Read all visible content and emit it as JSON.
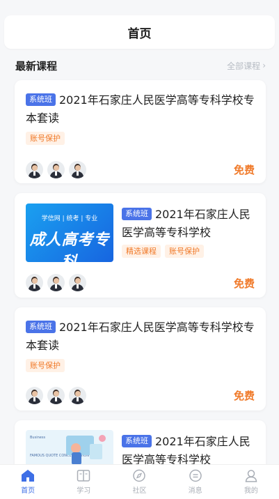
{
  "header": {
    "title": "首页"
  },
  "section": {
    "title": "最新课程",
    "more": "全部课程"
  },
  "cards": [
    {
      "badge": "系统班",
      "title": "2021年石家庄人民医学高等专科学校专本套读",
      "tags": [
        "账号保护"
      ],
      "price": "免费"
    },
    {
      "badge": "系统班",
      "title": "2021年石家庄人民医学高等专科学校",
      "tags": [
        "精选课程",
        "账号保护"
      ],
      "price": "免费",
      "thumb": {
        "small": "学信网 | 统考 | 专业",
        "big": "成人高考专科"
      }
    },
    {
      "badge": "系统班",
      "title": "2021年石家庄人民医学高等专科学校专本套读",
      "tags": [
        "账号保护"
      ],
      "price": "免费"
    },
    {
      "badge": "系统班",
      "title": "2021年石家庄人民医学高等专科学校",
      "thumb": {
        "mini": "Business",
        "mini2": "FAMOUS QUOTE CONCENTRATION"
      }
    }
  ],
  "tabbar": [
    {
      "label": "首页",
      "icon": "home-icon",
      "active": true
    },
    {
      "label": "学习",
      "icon": "book-icon",
      "active": false
    },
    {
      "label": "社区",
      "icon": "compass-icon",
      "active": false
    },
    {
      "label": "消息",
      "icon": "message-icon",
      "active": false
    },
    {
      "label": "我的",
      "icon": "user-icon",
      "active": false
    }
  ],
  "colors": {
    "accent": "#3e6fe6",
    "badge": "#4a73e8",
    "price": "#f07a2a",
    "tag_bg": "#fff1e6"
  }
}
